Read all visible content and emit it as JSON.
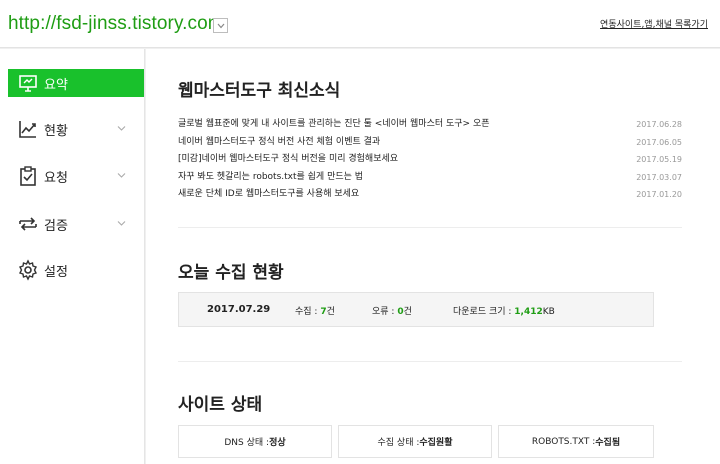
{
  "header": {
    "site_url": "http://fsd-jinss.tistory.com",
    "link_text": "연동사이트,앱,채널 목록가기"
  },
  "sidebar": {
    "items": [
      {
        "label": "요약",
        "active": true
      },
      {
        "label": "현황"
      },
      {
        "label": "요청"
      },
      {
        "label": "검증"
      },
      {
        "label": "설정"
      }
    ]
  },
  "news": {
    "title": "웹마스터도구 최신소식",
    "items": [
      {
        "title": "글로벌 웹표준에 맞게 내 사이트를 관리하는 진단 툴 <네이버 웹마스터 도구> 오픈",
        "date": "2017.06.28"
      },
      {
        "title": "네이버 웹마스터도구 정식 버전 사전 체험 이벤트 결과",
        "date": "2017.06.05"
      },
      {
        "title": "[미감]네이버 웹마스터도구 정식 버전을 미리 경험해보세요",
        "date": "2017.05.19"
      },
      {
        "title": "자꾸 봐도 헷갈리는 robots.txt를 쉽게 만드는 법",
        "date": "2017.03.07"
      },
      {
        "title": "새로운 단체 ID로 웹마스터도구를 사용해 보세요",
        "date": "2017.01.20"
      }
    ]
  },
  "today": {
    "title": "오늘 수집 현황",
    "date": "2017.07.29",
    "collect_label": "수집 : ",
    "collect_value": "7",
    "collect_unit": "건",
    "error_label": "오류 : ",
    "error_value": "0",
    "error_unit": "건",
    "download_label": "다운로드 크기 : ",
    "download_value": "1,412",
    "download_unit": "KB"
  },
  "site_status": {
    "title": "사이트 상태",
    "dns_label": "DNS 상태 : ",
    "dns_value": "정상",
    "collect_label": "수집 상태 : ",
    "collect_value": "수집원활",
    "robots_label": "ROBOTS.TXT : ",
    "robots_value": "수집됨"
  }
}
